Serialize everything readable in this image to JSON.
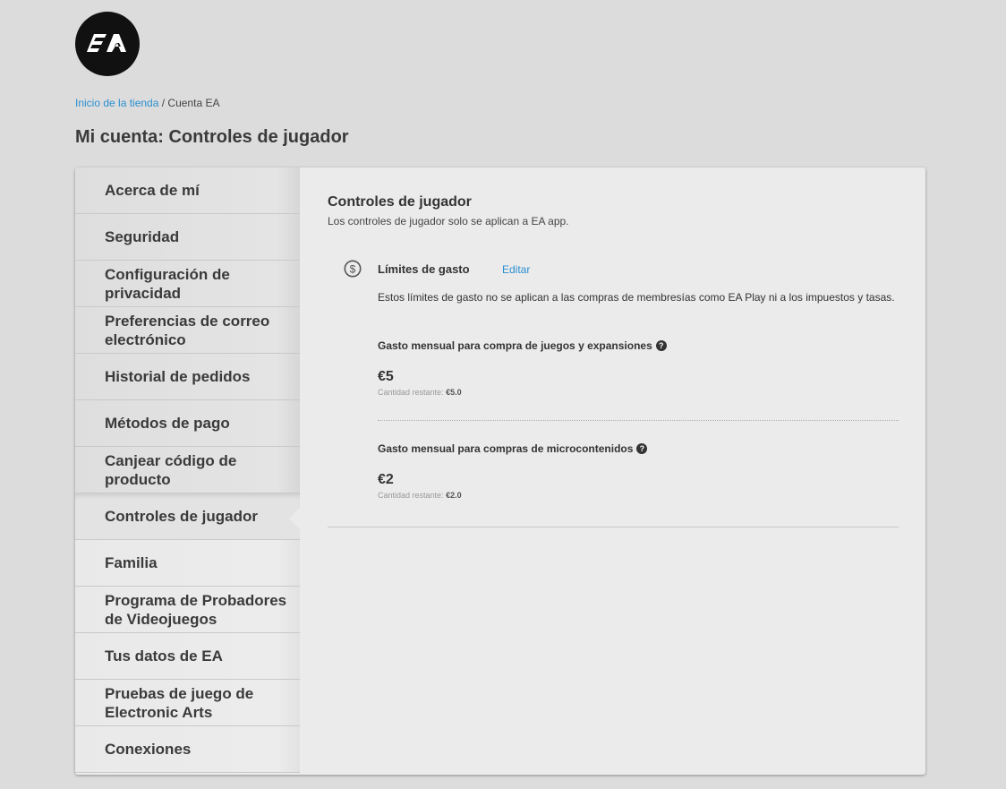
{
  "logo": {
    "text": "EA"
  },
  "breadcrumb": {
    "home": "Inicio de la tienda",
    "separator": " / ",
    "current": "Cuenta EA"
  },
  "page_title": "Mi cuenta: Controles de jugador",
  "sidebar": {
    "items": [
      {
        "label": "Acerca de mí"
      },
      {
        "label": "Seguridad"
      },
      {
        "label": "Configuración de privacidad"
      },
      {
        "label": "Preferencias de correo electrónico"
      },
      {
        "label": "Historial de pedidos"
      },
      {
        "label": "Métodos de pago"
      },
      {
        "label": "Canjear código de producto"
      },
      {
        "label": "Controles de jugador"
      },
      {
        "label": "Familia"
      },
      {
        "label": "Programa de Probadores de Videojuegos"
      },
      {
        "label": "Tus datos de EA"
      },
      {
        "label": "Pruebas de juego de Electronic Arts"
      },
      {
        "label": "Conexiones"
      }
    ],
    "active_index": 7
  },
  "main": {
    "title": "Controles de jugador",
    "subtitle": "Los controles de jugador solo se aplican a EA app.",
    "spending": {
      "icon": "dollar-circle-icon",
      "title": "Límites de gasto",
      "edit_label": "Editar",
      "description": "Estos límites de gasto no se aplican a las compras de membresías como EA Play ni a los impuestos y tasas.",
      "limits": [
        {
          "label": "Gasto mensual para compra de juegos y expansiones",
          "value": "€5",
          "remaining_label": "Cantidad restante:",
          "remaining_value": "€5.0"
        },
        {
          "label": "Gasto mensual para compras de microcontenidos",
          "value": "€2",
          "remaining_label": "Cantidad restante:",
          "remaining_value": "€2.0"
        }
      ],
      "help_glyph": "?"
    }
  },
  "colors": {
    "link": "#2a8fd0",
    "background": "#dcdcdc",
    "panel": "#ebebeb"
  }
}
